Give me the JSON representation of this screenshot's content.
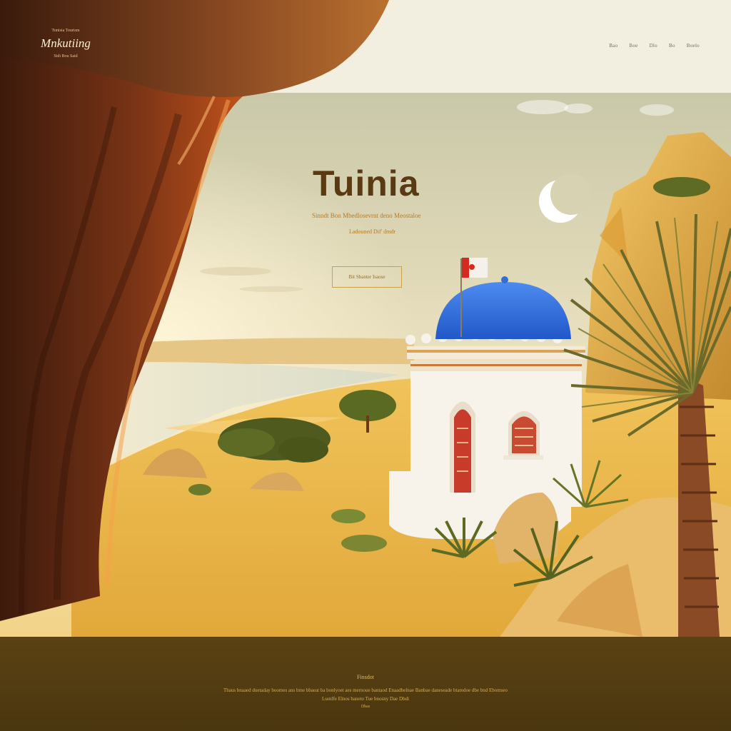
{
  "header": {
    "logo_top": "Tunisia Tourism",
    "logo_main": "Mnkutiing",
    "logo_sub": "Sidi Bou Said",
    "nav": [
      "Bao",
      "Boe",
      "Dlo",
      "Bo",
      "Boelo"
    ]
  },
  "hero": {
    "title": "Tuinia",
    "subtitle": "Sinndt Bon Mbedlosevrnt deno Meostaloe",
    "subtitle2": "Ladouned Dif' dmdr",
    "cta_label": "Bit Sbanter Isaose"
  },
  "footer": {
    "title": "Finsdot",
    "line1": "Thaus bnaaed duetaday boomes ans bme bbaeat ba bonlyoet aes mernoue bantaod Enaadbelnae Banbae daneseade btaredoe dbe bnd Ebomseo",
    "line2": "Lsenlfe Elnos baneto Tue bnosny Dae Dbdi",
    "line3": "Dhas"
  },
  "colors": {
    "sand": "#e9b948",
    "dome": "#2f6fd6",
    "curtain": "#c4521c",
    "footer_bg": "#4f3911",
    "accent": "#c9a04a"
  },
  "icons": [
    "crescent-moon-icon",
    "tunisia-flag-icon"
  ]
}
